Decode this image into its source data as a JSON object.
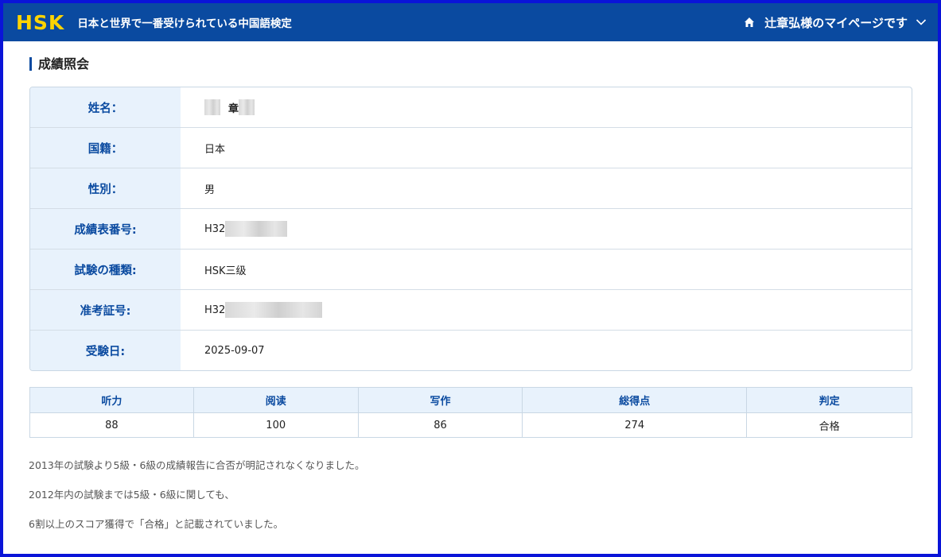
{
  "header": {
    "logo": "HSK",
    "tagline": "日本と世界で一番受けられている中国語検定",
    "user_menu_label": "辻章弘様のマイページです"
  },
  "section_title": "成績照会",
  "info": {
    "name_label": "姓名：",
    "name_value": "章",
    "nationality_label": "国籍：",
    "nationality_value": "日本",
    "gender_label": "性別：",
    "gender_value": "男",
    "report_no_label": "成績表番号:",
    "report_no_prefix": "H32",
    "exam_type_label": "試験の種類:",
    "exam_type_value": "HSK三级",
    "admission_no_label": "准考証号:",
    "admission_no_prefix": "H32",
    "exam_date_label": "受験日:",
    "exam_date_value": "2025-09-07"
  },
  "scores": {
    "headers": [
      "听力",
      "阅读",
      "写作",
      "総得点",
      "判定"
    ],
    "values": [
      "88",
      "100",
      "86",
      "274",
      "合格"
    ]
  },
  "notes": [
    "2013年の試験より5級・6級の成績報告に合否が明記されなくなりました。",
    "2012年内の試験までは5級・6級に関しても、",
    "6割以上のスコア獲得で「合格」と記載されていました。"
  ],
  "colors": {
    "header_bg": "#0a4aa0",
    "logo": "#ffd400",
    "label_bg": "#e8f2fc",
    "label_text": "#0a4aa0"
  }
}
